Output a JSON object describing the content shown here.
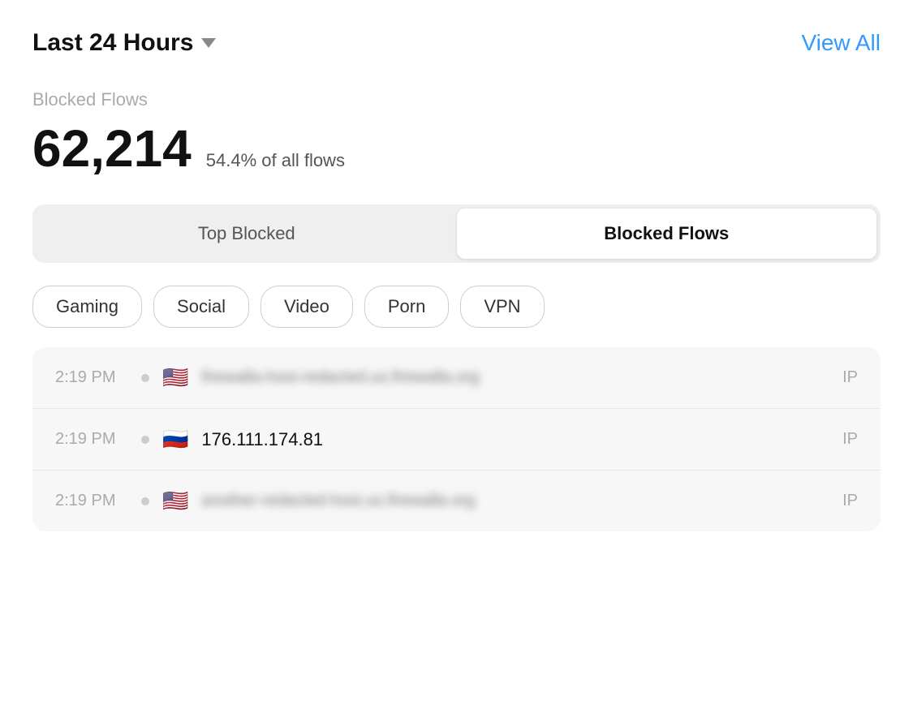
{
  "header": {
    "time_selector_label": "Last 24 Hours",
    "view_all_label": "View All"
  },
  "stats": {
    "section_label": "Blocked Flows",
    "big_number": "62,214",
    "percent_text": "54.4% of all flows"
  },
  "tabs": [
    {
      "id": "top-blocked",
      "label": "Top Blocked",
      "active": false
    },
    {
      "id": "blocked-flows",
      "label": "Blocked Flows",
      "active": true
    }
  ],
  "categories": [
    {
      "id": "gaming",
      "label": "Gaming"
    },
    {
      "id": "social",
      "label": "Social"
    },
    {
      "id": "video",
      "label": "Video"
    },
    {
      "id": "porn",
      "label": "Porn"
    },
    {
      "id": "vpn",
      "label": "VPN"
    }
  ],
  "flow_rows": [
    {
      "time": "2:19 PM",
      "flag": "🇺🇸",
      "host": "redacted-hostname.us.firewalla.org",
      "host_blurred": true,
      "type": "IP"
    },
    {
      "time": "2:19 PM",
      "flag": "🇷🇺",
      "host": "176.111.174.81",
      "host_blurred": false,
      "type": "IP"
    },
    {
      "time": "2:19 PM",
      "flag": "🇺🇸",
      "host": "another-redacted.us.firewalla.org",
      "host_blurred": true,
      "type": "IP"
    }
  ]
}
